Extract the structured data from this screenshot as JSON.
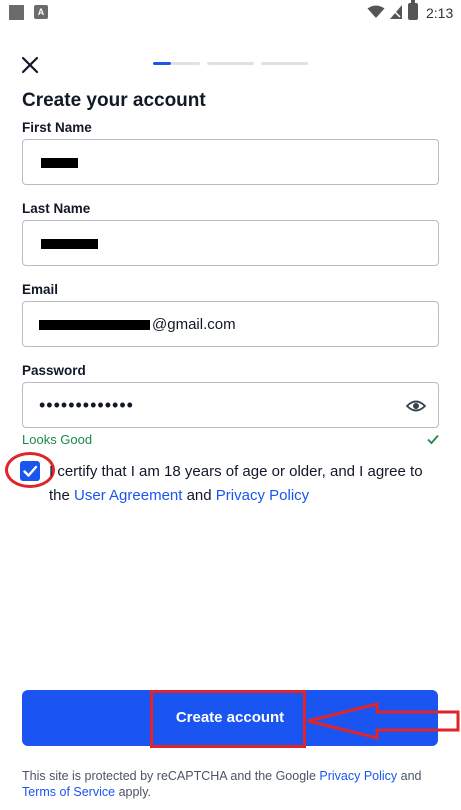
{
  "status_bar": {
    "time": "2:13",
    "notification_letter": "A"
  },
  "header": {
    "step_count": 3,
    "active_step": 1
  },
  "form": {
    "title": "Create your account",
    "first_name": {
      "label": "First Name",
      "value": ""
    },
    "last_name": {
      "label": "Last Name",
      "value": ""
    },
    "email": {
      "label": "Email",
      "value": "@gmail.com"
    },
    "password": {
      "label": "Password",
      "value": "•••••••••••••"
    },
    "validation": "Looks Good",
    "agree": {
      "text_before": "I certify that I am 18 years of age or older, and I agree to the",
      "user_agreement_link": "User Agreement",
      "and": "and",
      "privacy_policy_link": "Privacy Policy",
      "checked": true
    },
    "submit_label": "Create account"
  },
  "footer": {
    "text_before": "This site is protected by reCAPTCHA and the Google",
    "privacy_link": "Privacy Policy",
    "and": "and",
    "terms_link": "Terms of Service",
    "text_after": "apply."
  },
  "colors": {
    "accent": "#1a55f2",
    "success": "#1a8a4a",
    "annotation": "#e0242a"
  }
}
